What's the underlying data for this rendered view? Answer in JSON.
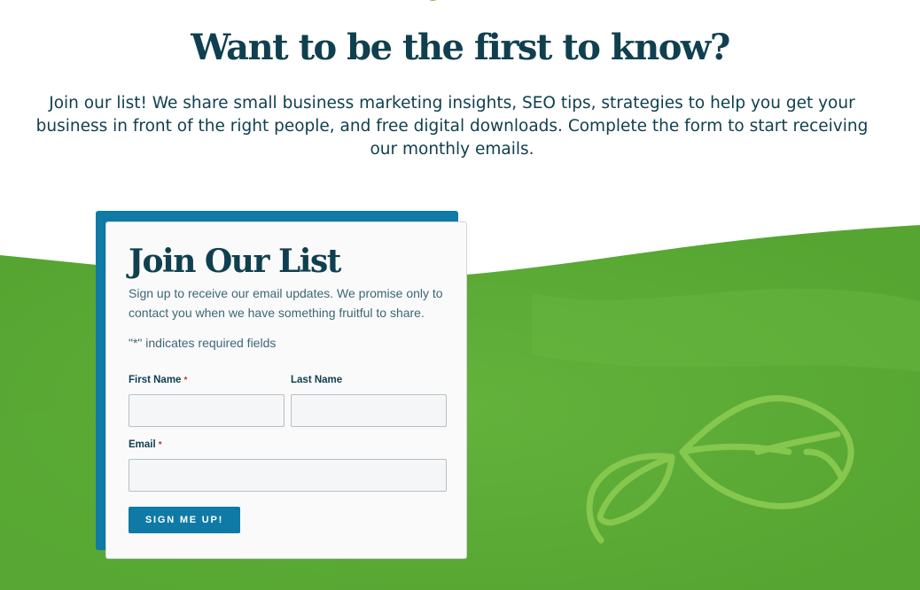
{
  "heading": "Want to be the first to know?",
  "intro": "Join our list! We share small business marketing insights, SEO tips, strategies to help you get your business in front of the right people, and free digital downloads. Complete the form to start receiving our monthly emails.",
  "form": {
    "title": "Join Our List",
    "description": "Sign up to receive our email updates. We promise only to contact you when we have something fruitful to share.",
    "required_note": "\"*\" indicates required fields",
    "first_name_label": "First Name",
    "last_name_label": "Last Name",
    "email_label": "Email",
    "required_marker": "*",
    "first_name_value": "",
    "last_name_value": "",
    "email_value": "",
    "submit_label": "SIGN ME UP!"
  },
  "colors": {
    "heading": "#10404f",
    "accent_blue": "#0f7aa5",
    "green_background": "#5fae3a",
    "leaf_outline": "#86c74e"
  },
  "icons": {
    "top_decoration": "leaf-icon",
    "background_decoration": "leaves-outline-icon"
  }
}
